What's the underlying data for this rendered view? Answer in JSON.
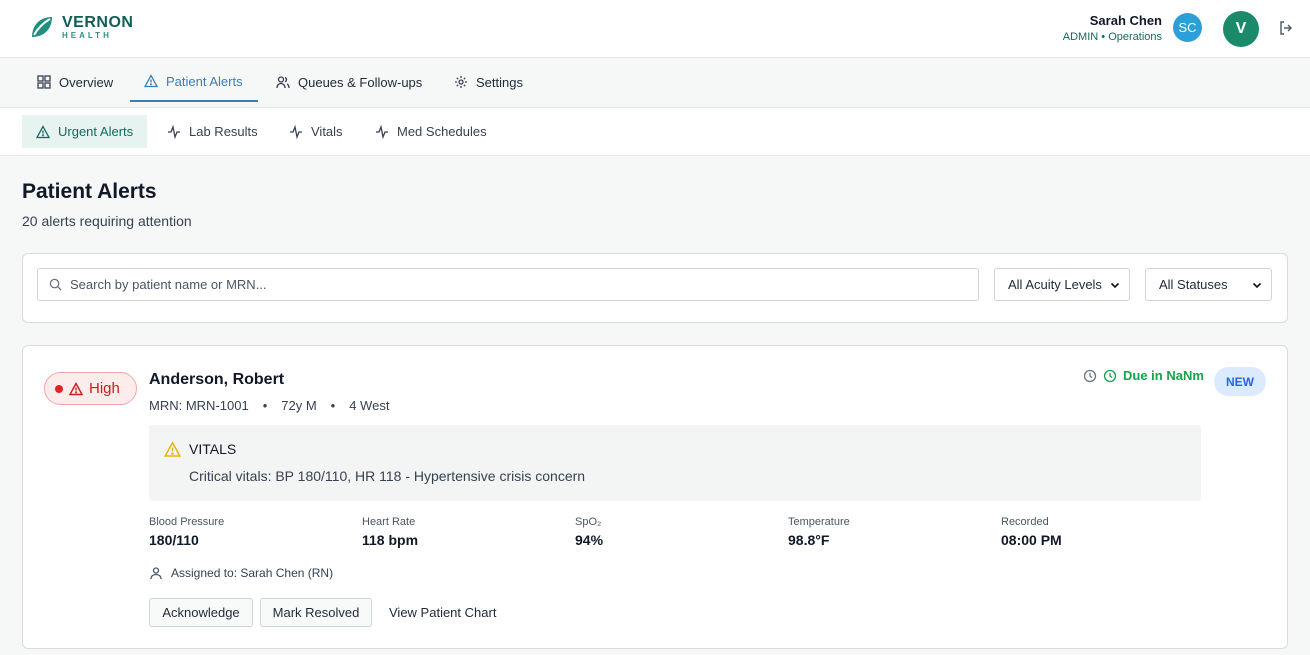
{
  "brand": {
    "name": "VERNON",
    "sub": "HEALTH",
    "accent": "#0f6b5e"
  },
  "user": {
    "name": "Sarah Chen",
    "role": "ADMIN • Operations",
    "initials": "SC",
    "org_initial": "V"
  },
  "main_nav": [
    {
      "label": "Overview",
      "icon": "grid-icon"
    },
    {
      "label": "Patient Alerts",
      "icon": "warning-icon",
      "active": true
    },
    {
      "label": "Queues & Follow-ups",
      "icon": "users-icon"
    },
    {
      "label": "Settings",
      "icon": "gear-icon"
    }
  ],
  "sub_nav": [
    {
      "label": "Urgent Alerts",
      "icon": "warning-icon",
      "active": true
    },
    {
      "label": "Lab Results",
      "icon": "activity-icon"
    },
    {
      "label": "Vitals",
      "icon": "activity-icon"
    },
    {
      "label": "Med Schedules",
      "icon": "activity-icon"
    }
  ],
  "page": {
    "title": "Patient Alerts",
    "subtitle": "20 alerts requiring attention"
  },
  "filters": {
    "search_placeholder": "Search by patient name or MRN...",
    "acuity": "All Acuity Levels",
    "status": "All Statuses"
  },
  "alert": {
    "acuity": "High",
    "patient_name": "Anderson, Robert",
    "mrn": "MRN: MRN-1001",
    "age_sex": "72y M",
    "unit": "4 West",
    "due": "Due in NaNm",
    "badge": "NEW",
    "category": "VITALS",
    "description": "Critical vitals: BP 180/110, HR 118 - Hypertensive crisis concern",
    "metrics": [
      {
        "label": "Blood Pressure",
        "value": "180/110"
      },
      {
        "label": "Heart Rate",
        "value": "118 bpm"
      },
      {
        "label": "SpO₂",
        "value": "94%"
      },
      {
        "label": "Temperature",
        "value": "98.8°F"
      },
      {
        "label": "Recorded",
        "value": "08:00 PM"
      }
    ],
    "assigned": "Assigned to: Sarah Chen (RN)",
    "actions": {
      "acknowledge": "Acknowledge",
      "resolve": "Mark Resolved",
      "chart": "View Patient Chart"
    }
  },
  "sep": "•"
}
